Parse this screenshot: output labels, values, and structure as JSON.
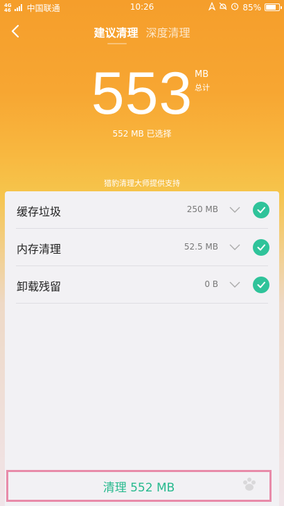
{
  "status_bar": {
    "network_top": "4G",
    "network_bottom": "46",
    "carrier": "中国联通",
    "time": "10:26",
    "battery_text": "85%",
    "battery_level": 0.85
  },
  "header": {
    "tabs": [
      {
        "label": "建议清理",
        "active": true
      },
      {
        "label": "深度清理",
        "active": false
      }
    ]
  },
  "summary": {
    "total_number": "553",
    "unit": "MB",
    "unit_caption": "总计",
    "selected_text": "552 MB 已选择"
  },
  "powered_by": "猎豹清理大师提供支持",
  "items": [
    {
      "name": "缓存垃圾",
      "size": "250 MB",
      "checked": true
    },
    {
      "name": "内存清理",
      "size": "52.5 MB",
      "checked": true
    },
    {
      "name": "卸载残留",
      "size": "0 B",
      "checked": true
    }
  ],
  "action_button": {
    "label": "清理 552 MB"
  },
  "colors": {
    "check_green": "#2fc39a",
    "button_text": "#26b98d",
    "highlight_border": "#e88ba9",
    "header_orange": "#f59e2b"
  }
}
